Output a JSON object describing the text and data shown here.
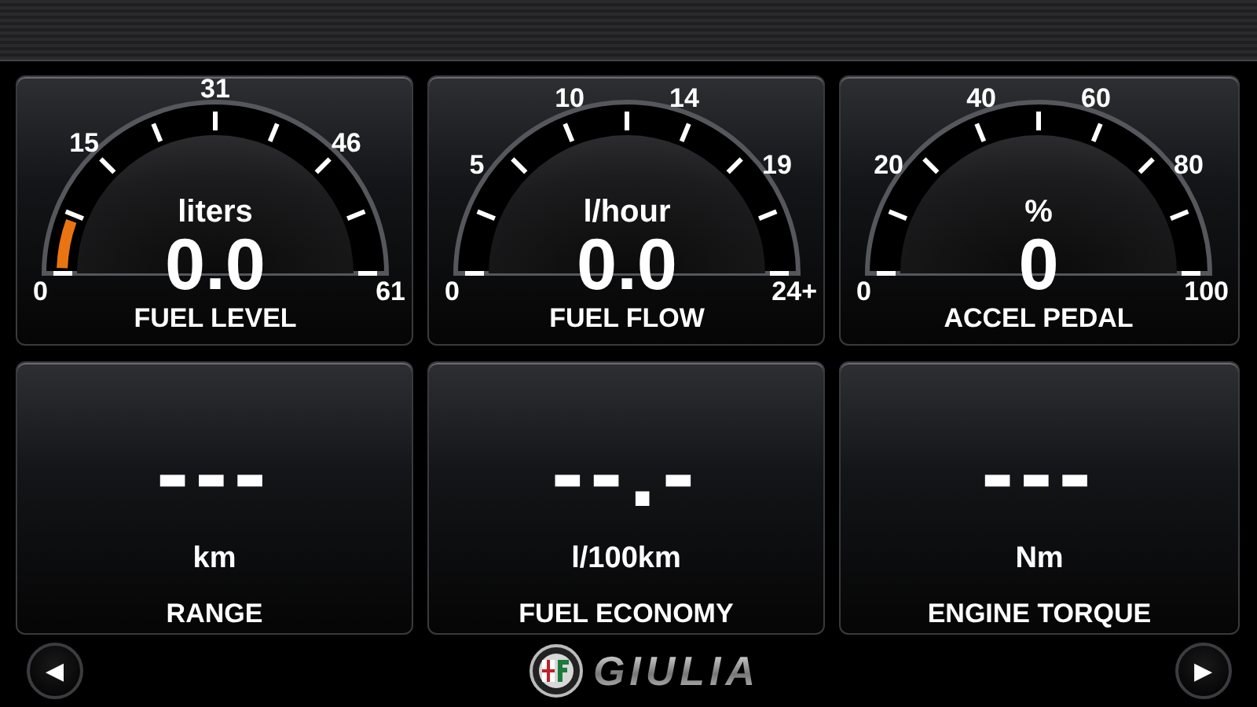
{
  "gauges": [
    {
      "unit": "liters",
      "value": "0.0",
      "label": "FUEL LEVEL",
      "scale": [
        "0",
        "15",
        "31",
        "46",
        "61"
      ],
      "level": 0.1
    },
    {
      "unit": "l/hour",
      "value": "0.0",
      "label": "FUEL FLOW",
      "scale": [
        "0",
        "5",
        "10",
        "14",
        "19",
        "24+"
      ]
    },
    {
      "unit": "%",
      "value": "0",
      "label": "ACCEL PEDAL",
      "scale": [
        "0",
        "20",
        "40",
        "60",
        "80",
        "100"
      ]
    }
  ],
  "readouts": [
    {
      "value": "---",
      "unit": "km",
      "label": "RANGE"
    },
    {
      "value": "--.-",
      "unit": "l/100km",
      "label": "FUEL ECONOMY"
    },
    {
      "value": "---",
      "unit": "Nm",
      "label": "ENGINE TORQUE"
    }
  ],
  "nav": {
    "prev": "◀",
    "next": "▶",
    "brand": "GIULIA"
  }
}
